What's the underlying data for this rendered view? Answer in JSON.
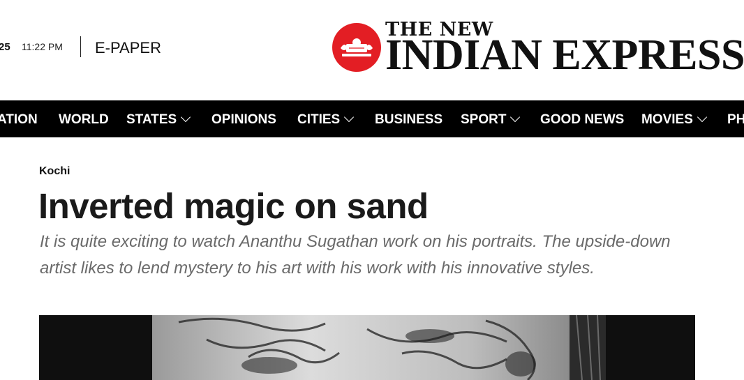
{
  "header": {
    "date_fragment": "25",
    "time": "11:22 PM",
    "epaper_label": "E-PAPER",
    "logo_top": "THE NEW",
    "logo_main": "INDIAN EXPRESS",
    "brand_color": "#e31e24"
  },
  "nav": {
    "items": [
      {
        "label": "ATION",
        "has_dropdown": false
      },
      {
        "label": "WORLD",
        "has_dropdown": false
      },
      {
        "label": "STATES",
        "has_dropdown": true
      },
      {
        "label": "OPINIONS",
        "has_dropdown": false
      },
      {
        "label": "CITIES",
        "has_dropdown": true
      },
      {
        "label": "BUSINESS",
        "has_dropdown": false
      },
      {
        "label": "SPORT",
        "has_dropdown": true
      },
      {
        "label": "GOOD NEWS",
        "has_dropdown": false
      },
      {
        "label": "MOVIES",
        "has_dropdown": true
      },
      {
        "label": "PH",
        "has_dropdown": false
      }
    ]
  },
  "article": {
    "category": "Kochi",
    "title": "Inverted magic on sand",
    "summary": "It is quite exciting to watch Ananthu Sugathan work on his portraits. The upside-down artist likes to lend mystery to his art with his work with his innovative styles."
  }
}
